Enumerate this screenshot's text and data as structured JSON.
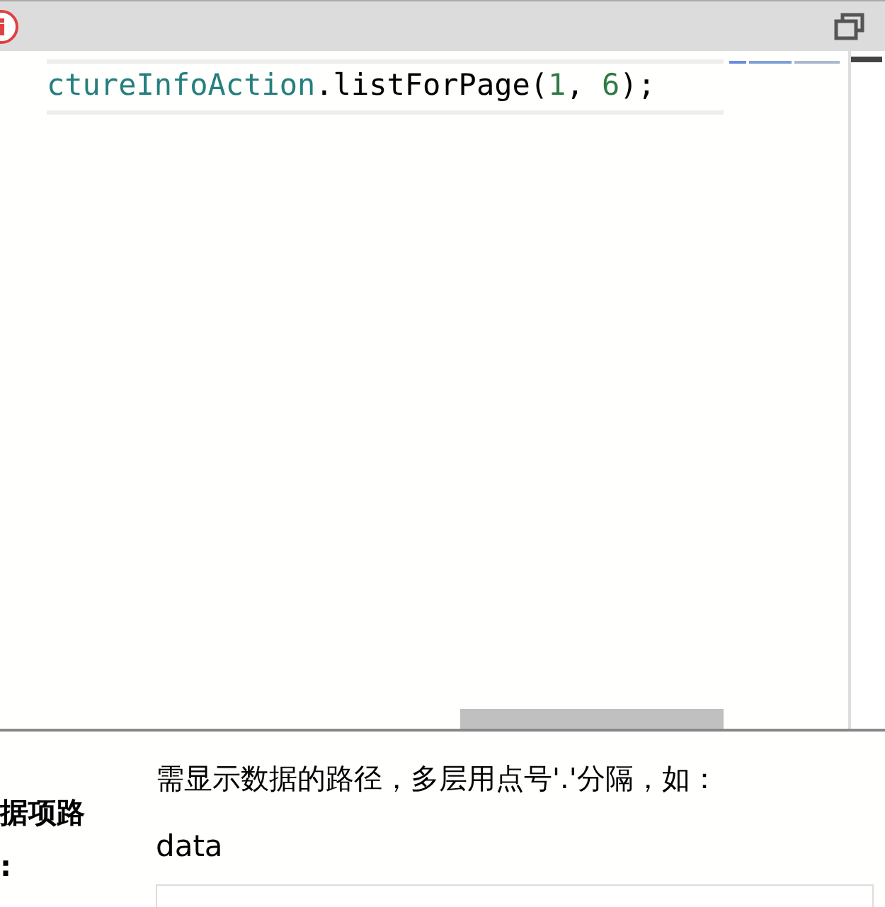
{
  "editor": {
    "code_line": [
      {
        "kind": "identifier",
        "text": "ctureInfoAction"
      },
      {
        "kind": "plain",
        "text": ".listForPage("
      },
      {
        "kind": "number",
        "text": "1"
      },
      {
        "kind": "plain",
        "text": ", "
      },
      {
        "kind": "number",
        "text": "6"
      },
      {
        "kind": "plain",
        "text": ");"
      }
    ]
  },
  "form": {
    "label_lines": [
      "据项路",
      ":"
    ],
    "hint": "需显示数据的路径，多层用点号'.'分隔，如：",
    "example": "data"
  }
}
